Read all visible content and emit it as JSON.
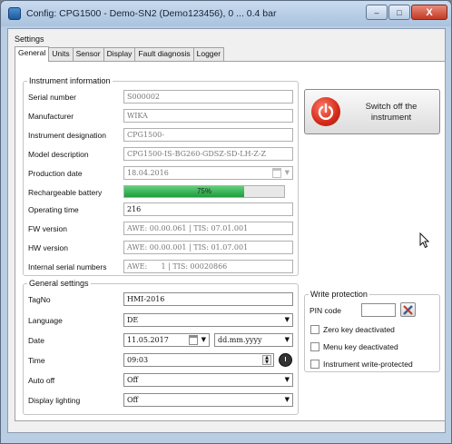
{
  "window": {
    "title": "Config: CPG1500 - Demo-SN2 (Demo123456), 0 ... 0.4 bar",
    "min_label": "–",
    "max_label": "□",
    "close_label": "X"
  },
  "settings_label": "Settings",
  "tabs": [
    {
      "label": "General",
      "active": true
    },
    {
      "label": "Units"
    },
    {
      "label": "Sensor"
    },
    {
      "label": "Display"
    },
    {
      "label": "Fault diagnosis"
    },
    {
      "label": "Logger"
    }
  ],
  "instrument_info": {
    "title": "Instrument information",
    "serial_number": {
      "label": "Serial number",
      "value": "S000002"
    },
    "manufacturer": {
      "label": "Manufacturer",
      "value": "WIKA"
    },
    "designation": {
      "label": "Instrument designation",
      "value": "CPG1500-"
    },
    "model": {
      "label": "Model description",
      "value": "CPG1500-IS-BG260-GDSZ-SD-LH-Z-Z"
    },
    "production_date": {
      "label": "Production date",
      "value": "18.04.2016"
    },
    "battery": {
      "label": "Rechargeable battery",
      "value_text": "75%",
      "percent": 75
    },
    "operating_time": {
      "label": "Operating time",
      "value": "216"
    },
    "fw_version": {
      "label": "FW version",
      "value": "AWE: 00.00.061 | TIS: 07.01.001"
    },
    "hw_version": {
      "label": "HW version",
      "value": "AWE: 00.00.001 | TIS: 01.07.001"
    },
    "internal_serial": {
      "label": "Internal serial numbers",
      "value": "AWE:      1 | TIS: 00020866"
    }
  },
  "switch_off": {
    "label": "Switch off the instrument"
  },
  "general_settings": {
    "title": "General settings",
    "tagno": {
      "label": "TagNo",
      "value": "HMI-2016"
    },
    "language": {
      "label": "Language",
      "value": "DE"
    },
    "date": {
      "label": "Date",
      "value": "11.05.2017",
      "format": "dd.mm.yyyy"
    },
    "time": {
      "label": "Time",
      "value": "09:03"
    },
    "auto_off": {
      "label": "Auto off",
      "value": "Off"
    },
    "display_lighting": {
      "label": "Display lighting",
      "value": "Off"
    }
  },
  "write_protection": {
    "title": "Write protection",
    "pin_label": "PIN code",
    "pin_value": "",
    "zero_key": {
      "label": "Zero key deactivated",
      "checked": false
    },
    "menu_key": {
      "label": "Menu key deactivated",
      "checked": false
    },
    "write_protected": {
      "label": "Instrument write-protected",
      "checked": false
    }
  },
  "colors": {
    "progress_fill": "#1f9c3c",
    "power_red": "#d42a18",
    "close_red": "#c23a22"
  }
}
